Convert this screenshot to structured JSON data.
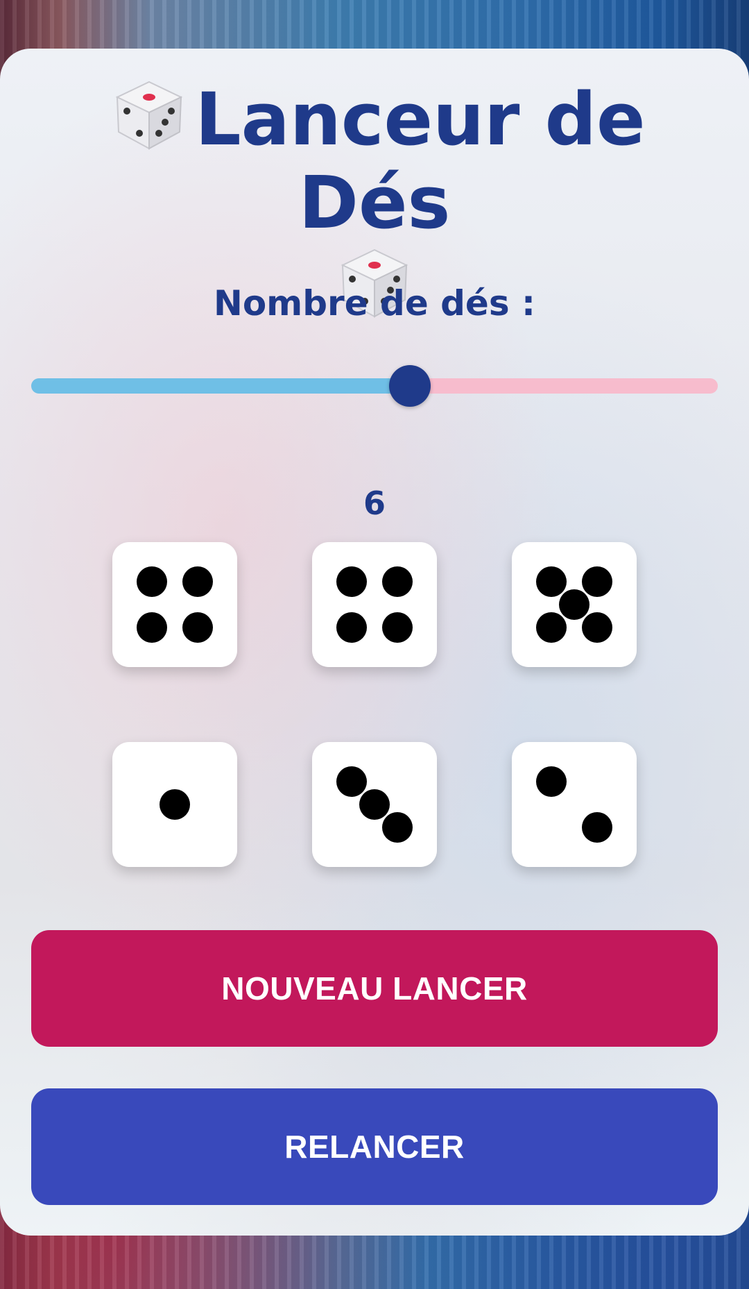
{
  "app": {
    "title": "Lanceur de Dés",
    "title_icon": "game-die-emoji"
  },
  "controls": {
    "dice_count_label": "Nombre de dés :",
    "dice_count_value": "6",
    "slider_fraction": 0.55
  },
  "dice": [
    4,
    4,
    5,
    1,
    3,
    2
  ],
  "buttons": {
    "new_roll": "NOUVEAU LANCER",
    "reroll": "RELANCER"
  },
  "colors": {
    "primary_text": "#1f3a8a",
    "new_roll_button": "#c2185b",
    "reroll_button": "#3949bb",
    "slider_active": "#6fbfe6",
    "slider_inactive": "#f7bccd"
  }
}
